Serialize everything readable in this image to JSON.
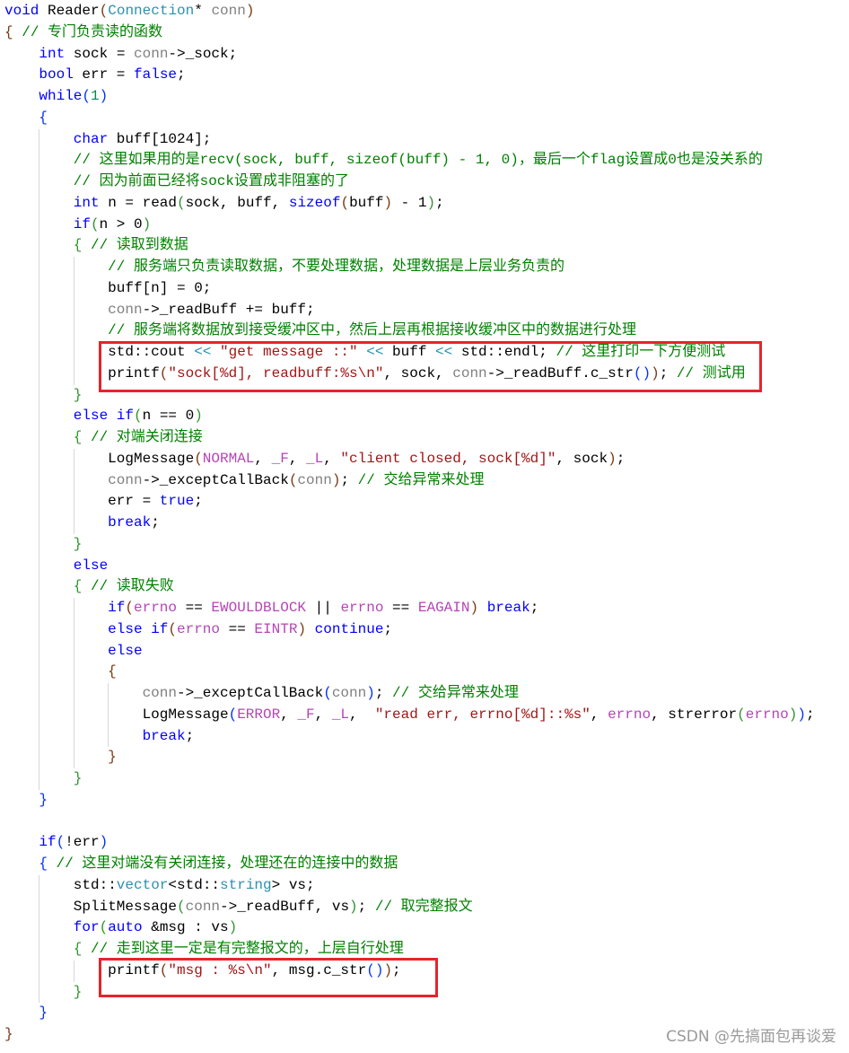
{
  "colors": {
    "keyword": "#0000ff",
    "comment": "#008000",
    "string": "#a31515",
    "parameter": "#808080",
    "type": "#2b91af",
    "number": "#098658",
    "macro": "#b545b5",
    "highlight_box": "#e8232b"
  },
  "lines": [
    {
      "ind": 0,
      "tk": [
        [
          "k",
          "void"
        ],
        [
          "d",
          " Reader"
        ],
        [
          "b1",
          "("
        ],
        [
          "t",
          "Connection"
        ],
        [
          "d",
          "* "
        ],
        [
          "p",
          "conn"
        ],
        [
          "b1",
          ")"
        ]
      ]
    },
    {
      "ind": 0,
      "tk": [
        [
          "b1",
          "{"
        ],
        [
          "c",
          " // 专门负责读的函数"
        ]
      ]
    },
    {
      "ind": 1,
      "tk": [
        [
          "k",
          "int"
        ],
        [
          "d",
          " sock = "
        ],
        [
          "p",
          "conn"
        ],
        [
          "d",
          "->_sock;"
        ]
      ]
    },
    {
      "ind": 1,
      "tk": [
        [
          "k",
          "bool"
        ],
        [
          "d",
          " err = "
        ],
        [
          "k",
          "false"
        ],
        [
          "d",
          ";"
        ]
      ]
    },
    {
      "ind": 1,
      "tk": [
        [
          "k",
          "while"
        ],
        [
          "b2",
          "("
        ],
        [
          "n",
          "1"
        ],
        [
          "b2",
          ")"
        ]
      ]
    },
    {
      "ind": 1,
      "tk": [
        [
          "b2",
          "{"
        ]
      ]
    },
    {
      "ind": 2,
      "tk": [
        [
          "k",
          "char"
        ],
        [
          "d",
          " buff[1024];"
        ]
      ]
    },
    {
      "ind": 2,
      "tk": [
        [
          "c",
          "// 这里如果用的是recv(sock, buff, sizeof(buff) - 1, 0)，最后一个flag设置成0也是没关系的"
        ]
      ]
    },
    {
      "ind": 2,
      "tk": [
        [
          "c",
          "// 因为前面已经将sock设置成非阻塞的了"
        ]
      ]
    },
    {
      "ind": 2,
      "tk": [
        [
          "k",
          "int"
        ],
        [
          "d",
          " n = read"
        ],
        [
          "b3",
          "("
        ],
        [
          "d",
          "sock, buff, "
        ],
        [
          "k",
          "sizeof"
        ],
        [
          "b1",
          "("
        ],
        [
          "d",
          "buff"
        ],
        [
          "b1",
          ")"
        ],
        [
          "d",
          " - 1"
        ],
        [
          "b3",
          ")"
        ],
        [
          "d",
          ";"
        ]
      ]
    },
    {
      "ind": 2,
      "tk": [
        [
          "k",
          "if"
        ],
        [
          "b3",
          "("
        ],
        [
          "d",
          "n > 0"
        ],
        [
          "b3",
          ")"
        ]
      ]
    },
    {
      "ind": 2,
      "tk": [
        [
          "b3",
          "{"
        ],
        [
          "c",
          " // 读取到数据"
        ]
      ]
    },
    {
      "ind": 3,
      "tk": [
        [
          "c",
          "// 服务端只负责读取数据，不要处理数据，处理数据是上层业务负责的"
        ]
      ]
    },
    {
      "ind": 3,
      "tk": [
        [
          "d",
          "buff[n] = 0;"
        ]
      ]
    },
    {
      "ind": 3,
      "tk": [
        [
          "p",
          "conn"
        ],
        [
          "d",
          "->_readBuff += buff;"
        ]
      ]
    },
    {
      "ind": 3,
      "tk": [
        [
          "c",
          "// 服务端将数据放到接受缓冲区中，然后上层再根据接收缓冲区中的数据进行处理"
        ]
      ]
    },
    {
      "ind": 3,
      "tk": [
        [
          "d",
          "std::cout "
        ],
        [
          "t",
          "<<"
        ],
        [
          "d",
          " "
        ],
        [
          "s",
          "\"get message ::\""
        ],
        [
          "d",
          " "
        ],
        [
          "t",
          "<<"
        ],
        [
          "d",
          " buff "
        ],
        [
          "t",
          "<<"
        ],
        [
          "d",
          " std::endl; "
        ],
        [
          "c",
          "// 这里打印一下方便测试"
        ]
      ]
    },
    {
      "ind": 3,
      "tk": [
        [
          "d",
          "printf"
        ],
        [
          "b1",
          "("
        ],
        [
          "s",
          "\"sock[%d], readbuff:%s\\n\""
        ],
        [
          "d",
          ", sock, "
        ],
        [
          "p",
          "conn"
        ],
        [
          "d",
          "->_readBuff.c_str"
        ],
        [
          "b2",
          "()"
        ],
        [
          "b1",
          ")"
        ],
        [
          "d",
          "; "
        ],
        [
          "c",
          "// 测试用"
        ]
      ]
    },
    {
      "ind": 2,
      "tk": [
        [
          "b3",
          "}"
        ]
      ]
    },
    {
      "ind": 2,
      "tk": [
        [
          "k",
          "else if"
        ],
        [
          "b3",
          "("
        ],
        [
          "d",
          "n == 0"
        ],
        [
          "b3",
          ")"
        ]
      ]
    },
    {
      "ind": 2,
      "tk": [
        [
          "b3",
          "{"
        ],
        [
          "c",
          " // 对端关闭连接"
        ]
      ]
    },
    {
      "ind": 3,
      "tk": [
        [
          "d",
          "LogMessage"
        ],
        [
          "b1",
          "("
        ],
        [
          "m",
          "NORMAL"
        ],
        [
          "d",
          ", "
        ],
        [
          "m",
          "_F"
        ],
        [
          "d",
          ", "
        ],
        [
          "m",
          "_L"
        ],
        [
          "d",
          ", "
        ],
        [
          "s",
          "\"client closed, sock[%d]\""
        ],
        [
          "d",
          ", sock"
        ],
        [
          "b1",
          ")"
        ],
        [
          "d",
          ";"
        ]
      ]
    },
    {
      "ind": 3,
      "tk": [
        [
          "p",
          "conn"
        ],
        [
          "d",
          "->_exceptCallBack"
        ],
        [
          "b1",
          "("
        ],
        [
          "p",
          "conn"
        ],
        [
          "b1",
          ")"
        ],
        [
          "d",
          "; "
        ],
        [
          "c",
          "// 交给异常来处理"
        ]
      ]
    },
    {
      "ind": 3,
      "tk": [
        [
          "d",
          "err = "
        ],
        [
          "k",
          "true"
        ],
        [
          "d",
          ";"
        ]
      ]
    },
    {
      "ind": 3,
      "tk": [
        [
          "k",
          "break"
        ],
        [
          "d",
          ";"
        ]
      ]
    },
    {
      "ind": 2,
      "tk": [
        [
          "b3",
          "}"
        ]
      ]
    },
    {
      "ind": 2,
      "tk": [
        [
          "k",
          "else"
        ]
      ]
    },
    {
      "ind": 2,
      "tk": [
        [
          "b3",
          "{"
        ],
        [
          "c",
          " // 读取失败"
        ]
      ]
    },
    {
      "ind": 3,
      "tk": [
        [
          "k",
          "if"
        ],
        [
          "b1",
          "("
        ],
        [
          "m",
          "errno"
        ],
        [
          "d",
          " == "
        ],
        [
          "m",
          "EWOULDBLOCK"
        ],
        [
          "d",
          " || "
        ],
        [
          "m",
          "errno"
        ],
        [
          "d",
          " == "
        ],
        [
          "m",
          "EAGAIN"
        ],
        [
          "b1",
          ")"
        ],
        [
          "d",
          " "
        ],
        [
          "k",
          "break"
        ],
        [
          "d",
          ";"
        ]
      ]
    },
    {
      "ind": 3,
      "tk": [
        [
          "k",
          "else if"
        ],
        [
          "b1",
          "("
        ],
        [
          "m",
          "errno"
        ],
        [
          "d",
          " == "
        ],
        [
          "m",
          "EINTR"
        ],
        [
          "b1",
          ")"
        ],
        [
          "d",
          " "
        ],
        [
          "k",
          "continue"
        ],
        [
          "d",
          ";"
        ]
      ]
    },
    {
      "ind": 3,
      "tk": [
        [
          "k",
          "else"
        ]
      ]
    },
    {
      "ind": 3,
      "tk": [
        [
          "b1",
          "{"
        ]
      ]
    },
    {
      "ind": 4,
      "tk": [
        [
          "p",
          "conn"
        ],
        [
          "d",
          "->_exceptCallBack"
        ],
        [
          "b2",
          "("
        ],
        [
          "p",
          "conn"
        ],
        [
          "b2",
          ")"
        ],
        [
          "d",
          "; "
        ],
        [
          "c",
          "// 交给异常来处理"
        ]
      ]
    },
    {
      "ind": 4,
      "tk": [
        [
          "d",
          "LogMessage"
        ],
        [
          "b2",
          "("
        ],
        [
          "m",
          "ERROR"
        ],
        [
          "d",
          ", "
        ],
        [
          "m",
          "_F"
        ],
        [
          "d",
          ", "
        ],
        [
          "m",
          "_L"
        ],
        [
          "d",
          ",  "
        ],
        [
          "s",
          "\"read err, errno[%d]::%s\""
        ],
        [
          "d",
          ", "
        ],
        [
          "m",
          "errno"
        ],
        [
          "d",
          ", strerror"
        ],
        [
          "b3",
          "("
        ],
        [
          "m",
          "errno"
        ],
        [
          "b3",
          ")"
        ],
        [
          "b2",
          ")"
        ],
        [
          "d",
          ";"
        ]
      ]
    },
    {
      "ind": 4,
      "tk": [
        [
          "k",
          "break"
        ],
        [
          "d",
          ";"
        ]
      ]
    },
    {
      "ind": 3,
      "tk": [
        [
          "b1",
          "}"
        ]
      ]
    },
    {
      "ind": 2,
      "tk": [
        [
          "b3",
          "}"
        ]
      ]
    },
    {
      "ind": 1,
      "tk": [
        [
          "b2",
          "}"
        ]
      ]
    },
    {
      "ind": 1,
      "tk": []
    },
    {
      "ind": 1,
      "tk": [
        [
          "k",
          "if"
        ],
        [
          "b2",
          "("
        ],
        [
          "d",
          "!err"
        ],
        [
          "b2",
          ")"
        ]
      ]
    },
    {
      "ind": 1,
      "tk": [
        [
          "b2",
          "{"
        ],
        [
          "c",
          " // 这里对端没有关闭连接，处理还在的连接中的数据"
        ]
      ]
    },
    {
      "ind": 2,
      "tk": [
        [
          "d",
          "std::"
        ],
        [
          "t",
          "vector"
        ],
        [
          "d",
          "<std::"
        ],
        [
          "t",
          "string"
        ],
        [
          "d",
          "> vs;"
        ]
      ]
    },
    {
      "ind": 2,
      "tk": [
        [
          "d",
          "SplitMessage"
        ],
        [
          "b3",
          "("
        ],
        [
          "p",
          "conn"
        ],
        [
          "d",
          "->_readBuff, vs"
        ],
        [
          "b3",
          ")"
        ],
        [
          "d",
          "; "
        ],
        [
          "c",
          "// 取完整报文"
        ]
      ]
    },
    {
      "ind": 2,
      "tk": [
        [
          "k",
          "for"
        ],
        [
          "b3",
          "("
        ],
        [
          "k",
          "auto"
        ],
        [
          "d",
          " &msg : vs"
        ],
        [
          "b3",
          ")"
        ]
      ]
    },
    {
      "ind": 2,
      "tk": [
        [
          "b3",
          "{"
        ],
        [
          "c",
          " // 走到这里一定是有完整报文的，上层自行处理"
        ]
      ]
    },
    {
      "ind": 3,
      "tk": [
        [
          "d",
          "printf"
        ],
        [
          "b1",
          "("
        ],
        [
          "s",
          "\"msg : %s\\n\""
        ],
        [
          "d",
          ", msg.c_str"
        ],
        [
          "b2",
          "()"
        ],
        [
          "b1",
          ")"
        ],
        [
          "d",
          ";"
        ]
      ]
    },
    {
      "ind": 2,
      "tk": [
        [
          "b3",
          "}"
        ]
      ]
    },
    {
      "ind": 1,
      "tk": [
        [
          "b2",
          "}"
        ]
      ]
    },
    {
      "ind": 0,
      "tk": [
        [
          "b1",
          "}"
        ]
      ]
    }
  ],
  "watermark": "CSDN @先搞面包再谈爱"
}
